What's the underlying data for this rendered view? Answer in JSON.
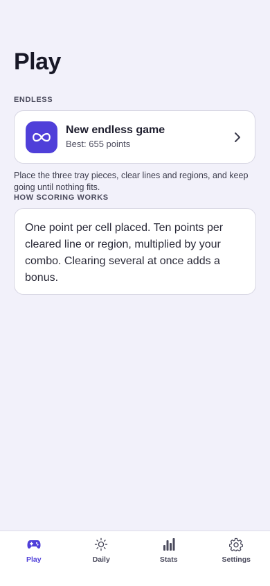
{
  "page": {
    "title": "Play"
  },
  "endless": {
    "section_label": "ENDLESS",
    "card": {
      "icon": "infinity-icon",
      "title": "New endless game",
      "subtitle": "Best: 655 points"
    },
    "description": "Place the three tray pieces, clear lines and regions, and keep going until nothing fits."
  },
  "scoring": {
    "section_label": "HOW SCORING WORKS",
    "text": "One point per cell placed. Ten points per cleared line or region, multiplied by your combo. Clearing several at once adds a bonus."
  },
  "tabbar": {
    "active": "Play",
    "tabs": [
      {
        "label": "Play",
        "icon": "gamepad-icon"
      },
      {
        "label": "Daily",
        "icon": "sun-icon"
      },
      {
        "label": "Stats",
        "icon": "bar-chart-icon"
      },
      {
        "label": "Settings",
        "icon": "gear-icon"
      }
    ]
  },
  "colors": {
    "accent": "#4F3FD9",
    "background": "#F2F1FA",
    "card": "#FFFFFF"
  }
}
